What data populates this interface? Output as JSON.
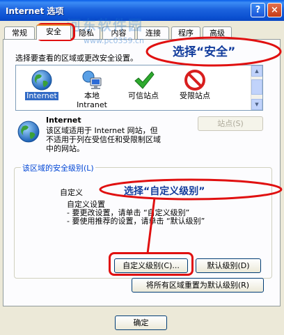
{
  "window": {
    "title": "Internet 选项",
    "help_glyph": "?",
    "close_glyph": "×"
  },
  "watermark": {
    "text": "河东软件园",
    "url": "www.pc0359.cn"
  },
  "tabs": [
    {
      "label": "常规"
    },
    {
      "label": "安全",
      "active": true
    },
    {
      "label": "隐私"
    },
    {
      "label": "内容"
    },
    {
      "label": "连接"
    },
    {
      "label": "程序"
    },
    {
      "label": "高级"
    }
  ],
  "security": {
    "instruction": "选择要查看的区域或更改安全设置。",
    "zones": [
      {
        "label": "Internet",
        "icon": "globe-icon",
        "selected": true
      },
      {
        "label_line1": "本地",
        "label_line2": "Intranet",
        "icon": "local-intranet-icon"
      },
      {
        "label": "可信站点",
        "icon": "trusted-check-icon"
      },
      {
        "label": "受限站点",
        "icon": "restricted-no-icon"
      }
    ],
    "zone_info": {
      "title": "Internet",
      "desc_line1": "该区域适用于 Internet 网站，但",
      "desc_line2": "不适用于列在受信任和受限制区域",
      "desc_line3": "中的网站。"
    },
    "sites_button": "站点(S)",
    "group_title": "该区域的安全级别(L)",
    "level_name": "自定义",
    "level_desc": [
      "自定义设置",
      "- 要更改设置，请单击 “自定义级别”",
      "- 要使用推荐的设置，请单击 “默认级别”"
    ],
    "custom_level_button": "自定义级别(C)...",
    "default_level_button": "默认级别(D)",
    "reset_all_button": "将所有区域重置为默认级别(R)"
  },
  "footer": {
    "ok_button": "确定"
  },
  "annotations": {
    "select_security": "选择“安全”",
    "select_custom_level": "选择“自定义级别”",
    "color": "#e01010"
  }
}
